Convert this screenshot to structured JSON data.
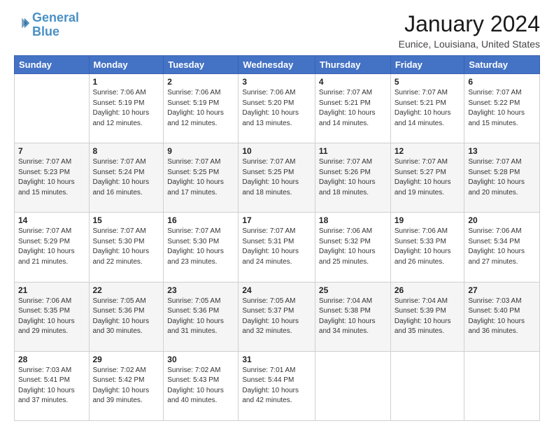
{
  "logo": {
    "line1": "General",
    "line2": "Blue"
  },
  "title": "January 2024",
  "subtitle": "Eunice, Louisiana, United States",
  "days_of_week": [
    "Sunday",
    "Monday",
    "Tuesday",
    "Wednesday",
    "Thursday",
    "Friday",
    "Saturday"
  ],
  "weeks": [
    [
      {
        "day": "",
        "info": ""
      },
      {
        "day": "1",
        "info": "Sunrise: 7:06 AM\nSunset: 5:19 PM\nDaylight: 10 hours\nand 12 minutes."
      },
      {
        "day": "2",
        "info": "Sunrise: 7:06 AM\nSunset: 5:19 PM\nDaylight: 10 hours\nand 12 minutes."
      },
      {
        "day": "3",
        "info": "Sunrise: 7:06 AM\nSunset: 5:20 PM\nDaylight: 10 hours\nand 13 minutes."
      },
      {
        "day": "4",
        "info": "Sunrise: 7:07 AM\nSunset: 5:21 PM\nDaylight: 10 hours\nand 14 minutes."
      },
      {
        "day": "5",
        "info": "Sunrise: 7:07 AM\nSunset: 5:21 PM\nDaylight: 10 hours\nand 14 minutes."
      },
      {
        "day": "6",
        "info": "Sunrise: 7:07 AM\nSunset: 5:22 PM\nDaylight: 10 hours\nand 15 minutes."
      }
    ],
    [
      {
        "day": "7",
        "info": "Sunrise: 7:07 AM\nSunset: 5:23 PM\nDaylight: 10 hours\nand 15 minutes."
      },
      {
        "day": "8",
        "info": "Sunrise: 7:07 AM\nSunset: 5:24 PM\nDaylight: 10 hours\nand 16 minutes."
      },
      {
        "day": "9",
        "info": "Sunrise: 7:07 AM\nSunset: 5:25 PM\nDaylight: 10 hours\nand 17 minutes."
      },
      {
        "day": "10",
        "info": "Sunrise: 7:07 AM\nSunset: 5:25 PM\nDaylight: 10 hours\nand 18 minutes."
      },
      {
        "day": "11",
        "info": "Sunrise: 7:07 AM\nSunset: 5:26 PM\nDaylight: 10 hours\nand 18 minutes."
      },
      {
        "day": "12",
        "info": "Sunrise: 7:07 AM\nSunset: 5:27 PM\nDaylight: 10 hours\nand 19 minutes."
      },
      {
        "day": "13",
        "info": "Sunrise: 7:07 AM\nSunset: 5:28 PM\nDaylight: 10 hours\nand 20 minutes."
      }
    ],
    [
      {
        "day": "14",
        "info": "Sunrise: 7:07 AM\nSunset: 5:29 PM\nDaylight: 10 hours\nand 21 minutes."
      },
      {
        "day": "15",
        "info": "Sunrise: 7:07 AM\nSunset: 5:30 PM\nDaylight: 10 hours\nand 22 minutes."
      },
      {
        "day": "16",
        "info": "Sunrise: 7:07 AM\nSunset: 5:30 PM\nDaylight: 10 hours\nand 23 minutes."
      },
      {
        "day": "17",
        "info": "Sunrise: 7:07 AM\nSunset: 5:31 PM\nDaylight: 10 hours\nand 24 minutes."
      },
      {
        "day": "18",
        "info": "Sunrise: 7:06 AM\nSunset: 5:32 PM\nDaylight: 10 hours\nand 25 minutes."
      },
      {
        "day": "19",
        "info": "Sunrise: 7:06 AM\nSunset: 5:33 PM\nDaylight: 10 hours\nand 26 minutes."
      },
      {
        "day": "20",
        "info": "Sunrise: 7:06 AM\nSunset: 5:34 PM\nDaylight: 10 hours\nand 27 minutes."
      }
    ],
    [
      {
        "day": "21",
        "info": "Sunrise: 7:06 AM\nSunset: 5:35 PM\nDaylight: 10 hours\nand 29 minutes."
      },
      {
        "day": "22",
        "info": "Sunrise: 7:05 AM\nSunset: 5:36 PM\nDaylight: 10 hours\nand 30 minutes."
      },
      {
        "day": "23",
        "info": "Sunrise: 7:05 AM\nSunset: 5:36 PM\nDaylight: 10 hours\nand 31 minutes."
      },
      {
        "day": "24",
        "info": "Sunrise: 7:05 AM\nSunset: 5:37 PM\nDaylight: 10 hours\nand 32 minutes."
      },
      {
        "day": "25",
        "info": "Sunrise: 7:04 AM\nSunset: 5:38 PM\nDaylight: 10 hours\nand 34 minutes."
      },
      {
        "day": "26",
        "info": "Sunrise: 7:04 AM\nSunset: 5:39 PM\nDaylight: 10 hours\nand 35 minutes."
      },
      {
        "day": "27",
        "info": "Sunrise: 7:03 AM\nSunset: 5:40 PM\nDaylight: 10 hours\nand 36 minutes."
      }
    ],
    [
      {
        "day": "28",
        "info": "Sunrise: 7:03 AM\nSunset: 5:41 PM\nDaylight: 10 hours\nand 37 minutes."
      },
      {
        "day": "29",
        "info": "Sunrise: 7:02 AM\nSunset: 5:42 PM\nDaylight: 10 hours\nand 39 minutes."
      },
      {
        "day": "30",
        "info": "Sunrise: 7:02 AM\nSunset: 5:43 PM\nDaylight: 10 hours\nand 40 minutes."
      },
      {
        "day": "31",
        "info": "Sunrise: 7:01 AM\nSunset: 5:44 PM\nDaylight: 10 hours\nand 42 minutes."
      },
      {
        "day": "",
        "info": ""
      },
      {
        "day": "",
        "info": ""
      },
      {
        "day": "",
        "info": ""
      }
    ]
  ]
}
